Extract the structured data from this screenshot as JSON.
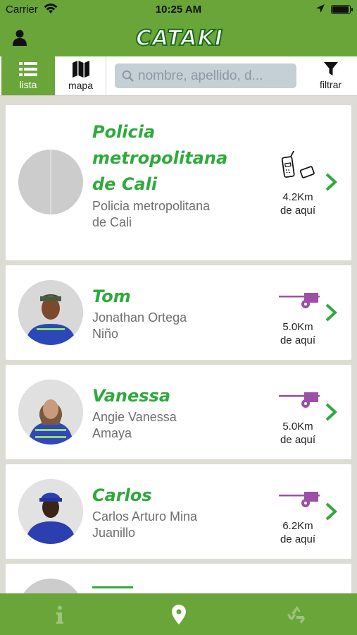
{
  "status": {
    "carrier": "Carrier",
    "time": "10:25 AM",
    "battery_level": 0.95
  },
  "header": {
    "logo_text": "CATAKI"
  },
  "toolbar": {
    "lista_label": "lista",
    "mapa_label": "mapa",
    "filter_label": "filtrar",
    "search_placeholder": "nombre, apellido, d..."
  },
  "list": [
    {
      "nickname_line1": "Policia",
      "nickname_line2": "metropolitana",
      "nickname_line3": "de Cali",
      "fullname": "Policia metropolitana de Cali",
      "vehicle_icon": "radio-icon",
      "distance": "4.2Km",
      "distance_suffix": "de aquí"
    },
    {
      "nickname": "Tom",
      "fullname": "Jonathan Ortega Niño",
      "vehicle_icon": "cart-icon",
      "distance": "5.0Km",
      "distance_suffix": "de aquí"
    },
    {
      "nickname": "Vanessa",
      "fullname": "Angie Vanessa Amaya",
      "vehicle_icon": "cart-icon",
      "distance": "5.0Km",
      "distance_suffix": "de aquí"
    },
    {
      "nickname": "Carlos",
      "fullname": "Carlos Arturo Mina Juanillo",
      "vehicle_icon": "cart-icon",
      "distance": "6.2Km",
      "distance_suffix": "de aquí"
    }
  ],
  "colors": {
    "brand_green": "#6aa53a",
    "name_green": "#2eaa3c",
    "cart_purple": "#9b4fa6",
    "search_bg": "#c5cfd6"
  },
  "bottom_nav": {
    "items": [
      "info-icon",
      "location-pin-icon",
      "recycle-icon"
    ],
    "active": "location-pin-icon"
  }
}
